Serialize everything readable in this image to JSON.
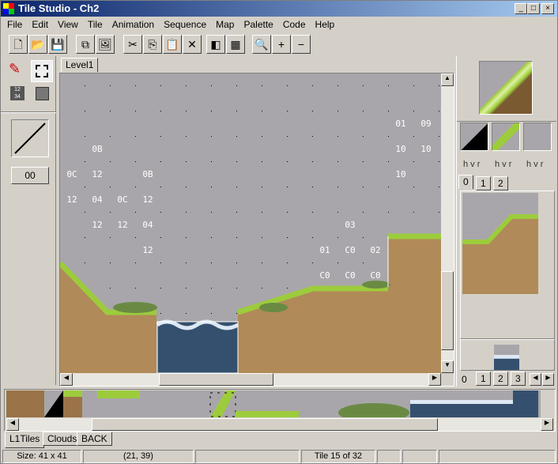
{
  "window": {
    "title": "Tile Studio - Ch2",
    "controls": [
      "_",
      "□",
      "×"
    ]
  },
  "menu": [
    "File",
    "Edit",
    "View",
    "Tile",
    "Animation",
    "Sequence",
    "Map",
    "Palette",
    "Code",
    "Help"
  ],
  "toolbar": [
    {
      "name": "new",
      "glyph": "🗋"
    },
    {
      "name": "open",
      "glyph": "📂"
    },
    {
      "name": "save",
      "glyph": "💾"
    },
    {
      "name": "copy-tile",
      "glyph": "⧉"
    },
    {
      "name": "import",
      "glyph": "🖼"
    },
    {
      "name": "cut",
      "glyph": "✂"
    },
    {
      "name": "copy",
      "glyph": "⎘"
    },
    {
      "name": "paste",
      "glyph": "📋"
    },
    {
      "name": "delete",
      "glyph": "✕"
    },
    {
      "name": "layer",
      "glyph": "◧"
    },
    {
      "name": "grid",
      "glyph": "▦"
    },
    {
      "name": "zoom",
      "glyph": "🔍"
    },
    {
      "name": "zoom-in",
      "glyph": "+"
    },
    {
      "name": "zoom-out",
      "glyph": "−"
    }
  ],
  "map_tabs": [
    "Level1"
  ],
  "left_panel": {
    "value_button": "00"
  },
  "map_labels": [
    {
      "row": 0,
      "col": 13,
      "text": "01"
    },
    {
      "row": 0,
      "col": 14,
      "text": "09"
    },
    {
      "row": 1,
      "col": 1,
      "text": "0B"
    },
    {
      "row": 1,
      "col": 13,
      "text": "10"
    },
    {
      "row": 1,
      "col": 14,
      "text": "10"
    },
    {
      "row": 2,
      "col": 0,
      "text": "0C"
    },
    {
      "row": 2,
      "col": 1,
      "text": "12"
    },
    {
      "row": 2,
      "col": 3,
      "text": "0B"
    },
    {
      "row": 2,
      "col": 13,
      "text": "10"
    },
    {
      "row": 3,
      "col": 0,
      "text": "12"
    },
    {
      "row": 3,
      "col": 1,
      "text": "04"
    },
    {
      "row": 3,
      "col": 2,
      "text": "0C"
    },
    {
      "row": 3,
      "col": 3,
      "text": "12"
    },
    {
      "row": 4,
      "col": 1,
      "text": "12"
    },
    {
      "row": 4,
      "col": 2,
      "text": "12"
    },
    {
      "row": 4,
      "col": 3,
      "text": "04"
    },
    {
      "row": 4,
      "col": 11,
      "text": "03"
    },
    {
      "row": 5,
      "col": 3,
      "text": "12"
    },
    {
      "row": 5,
      "col": 10,
      "text": "01"
    },
    {
      "row": 5,
      "col": 11,
      "text": "C0"
    },
    {
      "row": 5,
      "col": 12,
      "text": "02"
    },
    {
      "row": 6,
      "col": 10,
      "text": "C0"
    },
    {
      "row": 6,
      "col": 11,
      "text": "C0"
    },
    {
      "row": 6,
      "col": 12,
      "text": "C0"
    }
  ],
  "right_panel": {
    "hvr": [
      "h v r",
      "h v r",
      "h v r"
    ],
    "pattern_tabs": [
      "0",
      "1",
      "2"
    ],
    "seq_tabs": [
      "0",
      "1",
      "2",
      "3"
    ]
  },
  "tileset_tabs": [
    "L1Tiles",
    "Clouds",
    "BACK"
  ],
  "status": {
    "size": "Size: 41 x 41",
    "cursor": "(21, 39)",
    "tile": "Tile 15 of 32"
  },
  "colors": {
    "sky": "#a8a6aa",
    "dirt": "#b08a58",
    "grass": "#9ccc3c",
    "water": "#34506e",
    "titlebar": "#0a246a"
  }
}
